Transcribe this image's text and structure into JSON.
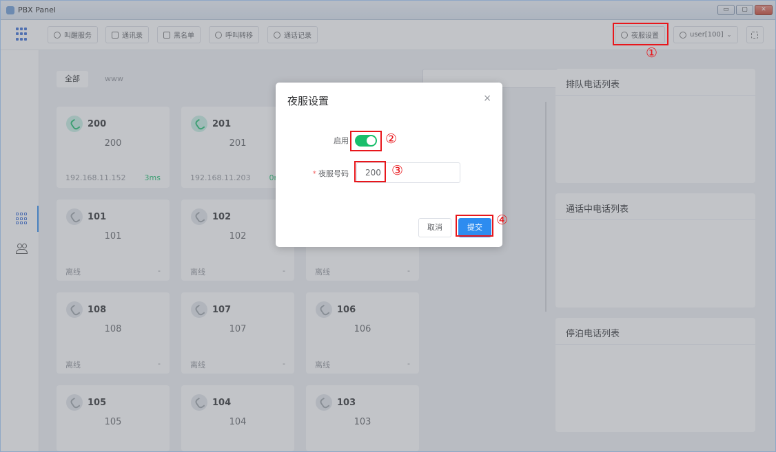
{
  "window": {
    "title": "PBX Panel",
    "min": "▭",
    "max": "▢",
    "close": "✕"
  },
  "toolbar": {
    "buttons": [
      {
        "label": "叫醒服务",
        "icon": "alarm-clock-icon"
      },
      {
        "label": "通讯录",
        "icon": "address-book-icon"
      },
      {
        "label": "黑名单",
        "icon": "blacklist-icon"
      },
      {
        "label": "呼叫转移",
        "icon": "call-forward-icon"
      },
      {
        "label": "通话记录",
        "icon": "call-history-icon"
      }
    ],
    "night_mode": "夜服设置",
    "user": "user[100]"
  },
  "filters": {
    "all": "全部",
    "group": "www"
  },
  "extensions": [
    {
      "ext": "200",
      "name": "200",
      "ip": "192.168.11.152",
      "latency": "3ms",
      "status": "",
      "online": true
    },
    {
      "ext": "201",
      "name": "201",
      "ip": "192.168.11.203",
      "latency": "0ms",
      "status": "",
      "online": true
    },
    {
      "ext": "101",
      "name": "101",
      "status": "离线",
      "dash": "-",
      "online": false
    },
    {
      "ext": "102",
      "name": "102",
      "status": "离线",
      "dash": "-",
      "online": false
    },
    {
      "ext": "",
      "name": "",
      "status": "离线",
      "dash": "-",
      "online": false
    },
    {
      "ext": "108",
      "name": "108",
      "status": "离线",
      "dash": "-",
      "online": false
    },
    {
      "ext": "107",
      "name": "107",
      "status": "离线",
      "dash": "-",
      "online": false
    },
    {
      "ext": "106",
      "name": "106",
      "status": "离线",
      "dash": "-",
      "online": false
    },
    {
      "ext": "105",
      "name": "105",
      "status": "",
      "online": false
    },
    {
      "ext": "104",
      "name": "104",
      "status": "",
      "online": false
    },
    {
      "ext": "103",
      "name": "103",
      "status": "",
      "online": false
    }
  ],
  "panels": {
    "queue": "排队电话列表",
    "active": "通话中电话列表",
    "parked": "停泊电话列表"
  },
  "modal": {
    "title": "夜服设置",
    "close": "×",
    "enable_label": "启用",
    "enabled": true,
    "number_label": "夜服号码",
    "required_mark": "*",
    "number_value": "200",
    "cancel": "取消",
    "submit": "提交"
  },
  "annotations": {
    "n1": "①",
    "n2": "②",
    "n3": "③",
    "n4": "④"
  },
  "colors": {
    "accent": "#2d8cf0",
    "online": "#19be6b",
    "highlight": "#e8161b"
  }
}
